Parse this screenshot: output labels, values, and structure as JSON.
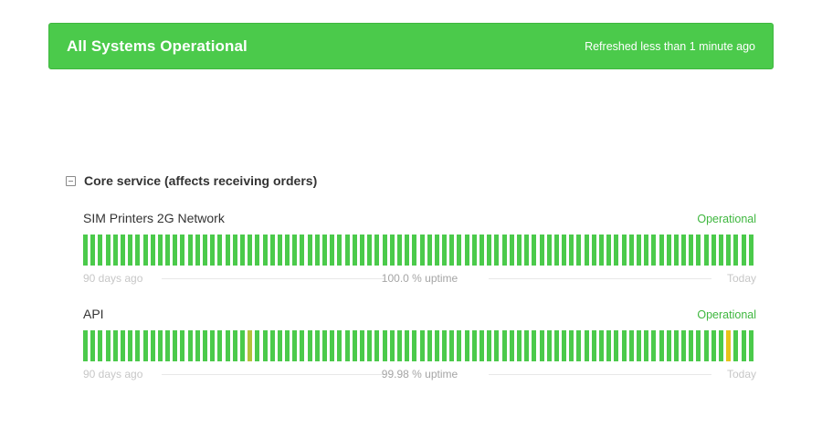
{
  "banner": {
    "title": "All Systems Operational",
    "refresh": "Refreshed less than 1 minute ago",
    "color": "#4bca4b"
  },
  "group": {
    "title": "Core service (affects receiving orders)",
    "icon": "collapse-minus-icon"
  },
  "components": [
    {
      "name": "SIM Printers 2G Network",
      "status": "Operational",
      "uptime": "100.0 % uptime",
      "range_start": "90 days ago",
      "range_end": "Today",
      "days": 90,
      "incident_days": []
    },
    {
      "name": "API",
      "status": "Operational",
      "uptime": "99.98 % uptime",
      "range_start": "90 days ago",
      "range_end": "Today",
      "days": 90,
      "incident_days": [
        {
          "day": 22,
          "level": "minor"
        },
        {
          "day": 86,
          "level": "warn"
        }
      ]
    }
  ],
  "colors": {
    "operational": "#4bca4b",
    "minor": "#b2c23a",
    "warn": "#e8c21a"
  }
}
